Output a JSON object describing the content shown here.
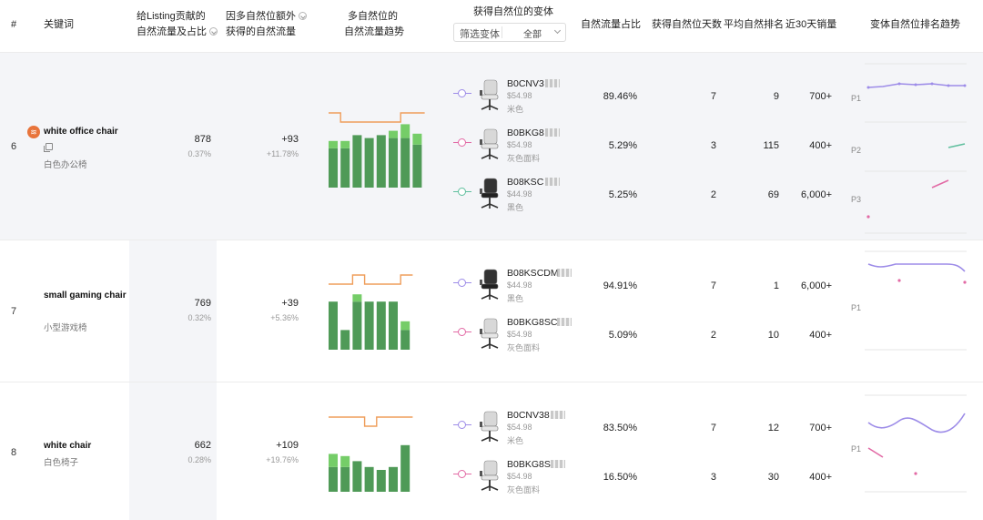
{
  "header": {
    "idx": "#",
    "keyword": "关键词",
    "traffic_line1": "给Listing贡献的",
    "traffic_line2": "自然流量及占比",
    "extra_line1": "因多自然位额外",
    "extra_line2": "获得的自然流量",
    "trend_line1": "多自然位的",
    "trend_line2": "自然流量趋势",
    "variants": "获得自然位的变体",
    "filter_label": "筛选变体",
    "filter_value": "全部",
    "share": "自然流量占比",
    "days": "获得自然位天数",
    "avg_rank": "平均自然排名",
    "sales30": "近30天销量",
    "rank_trend": "变体自然位排名趋势"
  },
  "colors": {
    "bar_dark": "#4f9a57",
    "bar_light": "#75cd68",
    "step_line": "#ef9d5a",
    "purple": "#9d8ce8",
    "pink": "#e26aa5",
    "teal": "#5fbf9e",
    "icon_orange": "#e8743b"
  },
  "rows": [
    {
      "idx": "6",
      "keyword": "white office chair",
      "keyword_cn": "白色办公椅",
      "traffic": "878",
      "traffic_pct": "0.37%",
      "extra": "+93",
      "extra_pct": "+11.78%",
      "bars": [
        [
          0.54,
          0.1
        ],
        [
          0.54,
          0.1
        ],
        [
          0.72,
          0.0
        ],
        [
          0.68,
          0.0
        ],
        [
          0.72,
          0.0
        ],
        [
          0.68,
          0.1
        ],
        [
          0.68,
          0.19
        ],
        [
          0.59,
          0.15
        ]
      ],
      "steps": [
        2,
        1,
        1,
        1,
        1,
        1,
        2,
        2
      ],
      "variants": [
        {
          "asin": "B0CNV3",
          "price": "$54.98",
          "color": "米色",
          "share": "89.46%",
          "days": "7",
          "avg_rank": "9",
          "sales": "700+",
          "node": "purple",
          "chair": "white"
        },
        {
          "asin": "B0BKG8",
          "price": "$54.98",
          "color": "灰色面料",
          "share": "5.29%",
          "days": "3",
          "avg_rank": "115",
          "sales": "400+",
          "node": "pink",
          "chair": "white"
        },
        {
          "asin": "B08KSC",
          "price": "$44.98",
          "color": "黑色",
          "share": "5.25%",
          "days": "2",
          "avg_rank": "69",
          "sales": "6,000+",
          "node": "teal",
          "chair": "black"
        }
      ],
      "trend_labels": [
        "P1",
        "P2",
        "P3"
      ]
    },
    {
      "idx": "7",
      "keyword": "small gaming chair",
      "keyword_cn": "小型游戏椅",
      "traffic": "769",
      "traffic_pct": "0.32%",
      "extra": "+39",
      "extra_pct": "+5.36%",
      "bars": [
        [
          0.66,
          0.0
        ],
        [
          0.27,
          0.0
        ],
        [
          0.66,
          0.1
        ],
        [
          0.66,
          0.0
        ],
        [
          0.66,
          0.0
        ],
        [
          0.66,
          0.0
        ],
        [
          0.27,
          0.12
        ]
      ],
      "steps": [
        1,
        1,
        2,
        1,
        1,
        1,
        2
      ],
      "variants": [
        {
          "asin": "B08KSCDM",
          "price": "$44.98",
          "color": "黑色",
          "share": "94.91%",
          "days": "7",
          "avg_rank": "1",
          "sales": "6,000+",
          "node": "purple",
          "chair": "black"
        },
        {
          "asin": "B0BKG8SC",
          "price": "$54.98",
          "color": "灰色面料",
          "share": "5.09%",
          "days": "2",
          "avg_rank": "10",
          "sales": "400+",
          "node": "pink",
          "chair": "white"
        }
      ],
      "trend_labels": [
        "P1"
      ]
    },
    {
      "idx": "8",
      "keyword": "white chair",
      "keyword_cn": "白色椅子",
      "traffic": "662",
      "traffic_pct": "0.28%",
      "extra": "+109",
      "extra_pct": "+19.76%",
      "bars": [
        [
          0.34,
          0.18
        ],
        [
          0.34,
          0.15
        ],
        [
          0.42,
          0.0
        ],
        [
          0.34,
          0.0
        ],
        [
          0.3,
          0.0
        ],
        [
          0.34,
          0.0
        ],
        [
          0.64,
          0.0
        ]
      ],
      "steps": [
        2,
        2,
        2,
        1,
        2,
        2,
        2
      ],
      "variants": [
        {
          "asin": "B0CNV38",
          "price": "$54.98",
          "color": "米色",
          "share": "83.50%",
          "days": "7",
          "avg_rank": "12",
          "sales": "700+",
          "node": "purple",
          "chair": "white"
        },
        {
          "asin": "B0BKG8S",
          "price": "$54.98",
          "color": "灰色面料",
          "share": "16.50%",
          "days": "3",
          "avg_rank": "30",
          "sales": "400+",
          "node": "pink",
          "chair": "white"
        }
      ],
      "trend_labels": [
        "P1"
      ]
    }
  ]
}
